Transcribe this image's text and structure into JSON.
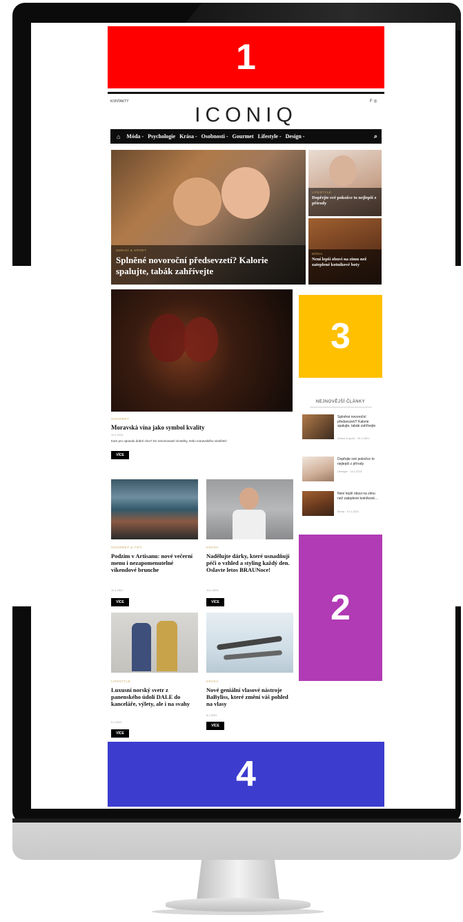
{
  "ads": {
    "top": "1",
    "right_mid": "2",
    "right_top": "3",
    "bottom": "4"
  },
  "colors": {
    "ad1": "#ff0000",
    "ad2": "#b13ab5",
    "ad3": "#ffc000",
    "ad4": "#3c3ccf"
  },
  "site": {
    "topbar_left": "KONTAKTY",
    "topbar_right": "f  ◎",
    "logo": "ICONIQ"
  },
  "nav": {
    "home_icon": "home-icon",
    "items": [
      "Móda -",
      "Psychologie",
      "Krása -",
      "Osobnosti -",
      "Gourmet",
      "Lifestyle -",
      "Design -"
    ],
    "search_icon": "search-icon"
  },
  "hero": {
    "main": {
      "category": "ZDRAVÍ & SPORT",
      "title": "Splněné novoroční předsevzetí? Kalorie spalujte, tabák zahřívejte"
    },
    "side1": {
      "category": "LIFESTYLE",
      "title": "Dopřejte své pokožce to nejlepší z přírody"
    },
    "side2": {
      "category": "MÓDA",
      "title": "Není lepší obuvi na zimu než zateplené kotníkové boty"
    }
  },
  "feature": {
    "category": "GOURMET",
    "title": "Moravská vína jako symbol kvality",
    "date": "12.1.2021",
    "excerpt": "Kam pro opravdu dobré víno? Do renomované vinotéky, nebo moravského vinařství!",
    "more": "VÍCE"
  },
  "sidebar": {
    "title": "NEJNOVĚJŠÍ ČLÁNKY",
    "items": [
      {
        "title": "Splněné novoroční předsevzetí? Kalorie spalujte, tabák zahřívejte",
        "date": "Zdraví & sport · 15.1.2021"
      },
      {
        "title": "Dopřejte své pokožce to nejlepší z přírody",
        "date": "Lifestyle · 14.1.2021"
      },
      {
        "title": "Není lepší obuvi na zimu než zateplené kotníkové...",
        "date": "Móda · 13.1.2021"
      }
    ]
  },
  "grid": [
    {
      "category": "GOURMET & TIPY",
      "title": "Podzim v Artisanu: nové večerní menu i nezapomenutelné víkendové brunche",
      "date": "11.1.2021",
      "more": "VÍCE"
    },
    {
      "category": "KRÁSA",
      "title": "Nadělujte dárky, které usnadňují péči o vzhled a styling každý den. Oslavte letos BRAUNoce!",
      "date": "10.1.2021",
      "more": "VÍCE"
    },
    {
      "category": "LIFESTYLE",
      "title": "Luxusní norský svetr z panenského údolí DALE do kanceláře, výlety, ale i na svahy",
      "date": "9.1.2021",
      "more": "VÍCE"
    },
    {
      "category": "KRÁSA",
      "title": "Nové geniální vlasové nástroje BaByliss, které změní váš pohled na vlasy",
      "date": "8.1.2021",
      "more": "VÍCE"
    }
  ]
}
